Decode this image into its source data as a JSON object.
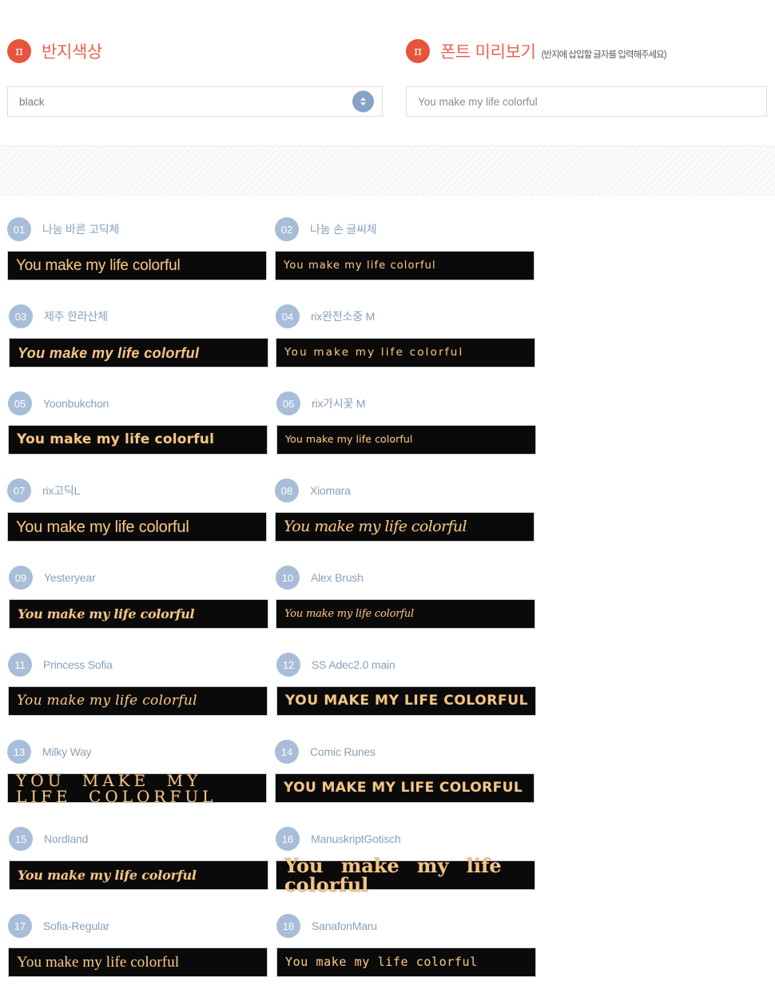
{
  "panels": {
    "color": {
      "icon": "pi-icon",
      "title": "반지색상",
      "select_value": "black"
    },
    "preview": {
      "icon": "pi-icon",
      "title": "폰트 미리보기",
      "note": "(반지에 삽입할 글자를 입력해주세요)",
      "input_value": "You make my life colorful"
    }
  },
  "fonts": [
    {
      "num": "01",
      "name": "나눔 바른 고딕체",
      "sample": "You make my life colorful"
    },
    {
      "num": "02",
      "name": "나눔 손 글씨체",
      "sample": "You make my life colorful"
    },
    {
      "num": "03",
      "name": "제주 한라산체",
      "sample": "You make my life colorful"
    },
    {
      "num": "04",
      "name": "rix완전소중 M",
      "sample": "You make my life colorful"
    },
    {
      "num": "05",
      "name": "Yoonbukchon",
      "sample": "You make my life colorful"
    },
    {
      "num": "06",
      "name": "rix가시꽃 M",
      "sample": "You make my life colorful"
    },
    {
      "num": "07",
      "name": "rix고딕L",
      "sample": "You make my life colorful"
    },
    {
      "num": "08",
      "name": "Xiomara",
      "sample": "You make my life colorful"
    },
    {
      "num": "09",
      "name": "Yesteryear",
      "sample": "You make my life colorful"
    },
    {
      "num": "10",
      "name": "Alex Brush",
      "sample": "You make my life colorful"
    },
    {
      "num": "11",
      "name": "Princess Sofia",
      "sample": "You make my life colorful"
    },
    {
      "num": "12",
      "name": "SS Adec2.0 main",
      "sample": "You make my life colorful"
    },
    {
      "num": "13",
      "name": "Milky Way",
      "sample": "You make my life colorful"
    },
    {
      "num": "14",
      "name": "Comic Runes",
      "sample": "You make my life colorful"
    },
    {
      "num": "15",
      "name": "Nordland",
      "sample": "You make my life colorful"
    },
    {
      "num": "16",
      "name": "ManuskriptGotisch",
      "sample": "You make my life colorful"
    },
    {
      "num": "17",
      "name": "Sofia-Regular",
      "sample": "You make my life colorful"
    },
    {
      "num": "18",
      "name": "SanafonMaru",
      "sample": "You make my life colorful"
    }
  ],
  "colors": {
    "accent": "#e8533c",
    "title": "#e8644f",
    "badge": "#a8bdd8",
    "font_name": "#8aa0b8",
    "preview_bg": "#0a0a0a",
    "preview_text": "#f1c589",
    "stepper": "#86a2c6"
  }
}
